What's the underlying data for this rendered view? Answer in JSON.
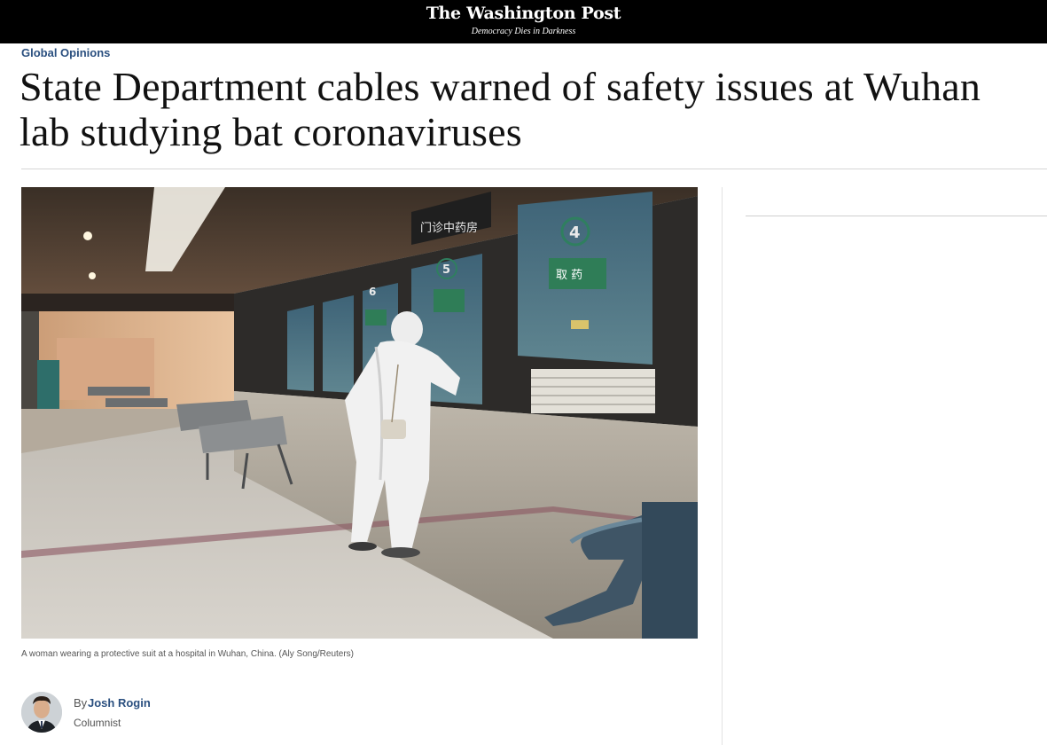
{
  "masthead": {
    "logo": "The Washington Post",
    "tagline": "Democracy Dies in Darkness"
  },
  "article": {
    "section": "Global Opinions",
    "headline_line1": "State Department cables warned of safety issues at Wuhan",
    "headline_line2": "lab studying bat coronaviruses",
    "photo_caption": "A woman wearing a protective suit at a hospital in Wuhan, China. (Aly Song/Reuters)",
    "photo_signs": {
      "sign_left": "门诊中药房",
      "window_4": "4",
      "window_5": "5",
      "window_6": "6",
      "pickup_label": "取 药"
    }
  },
  "byline": {
    "prefix": "By",
    "author": "Josh Rogin",
    "role": "Columnist"
  },
  "colors": {
    "masthead_bg": "#000000",
    "section_link": "#2a4f7f",
    "author_link": "#2a4f7f"
  }
}
